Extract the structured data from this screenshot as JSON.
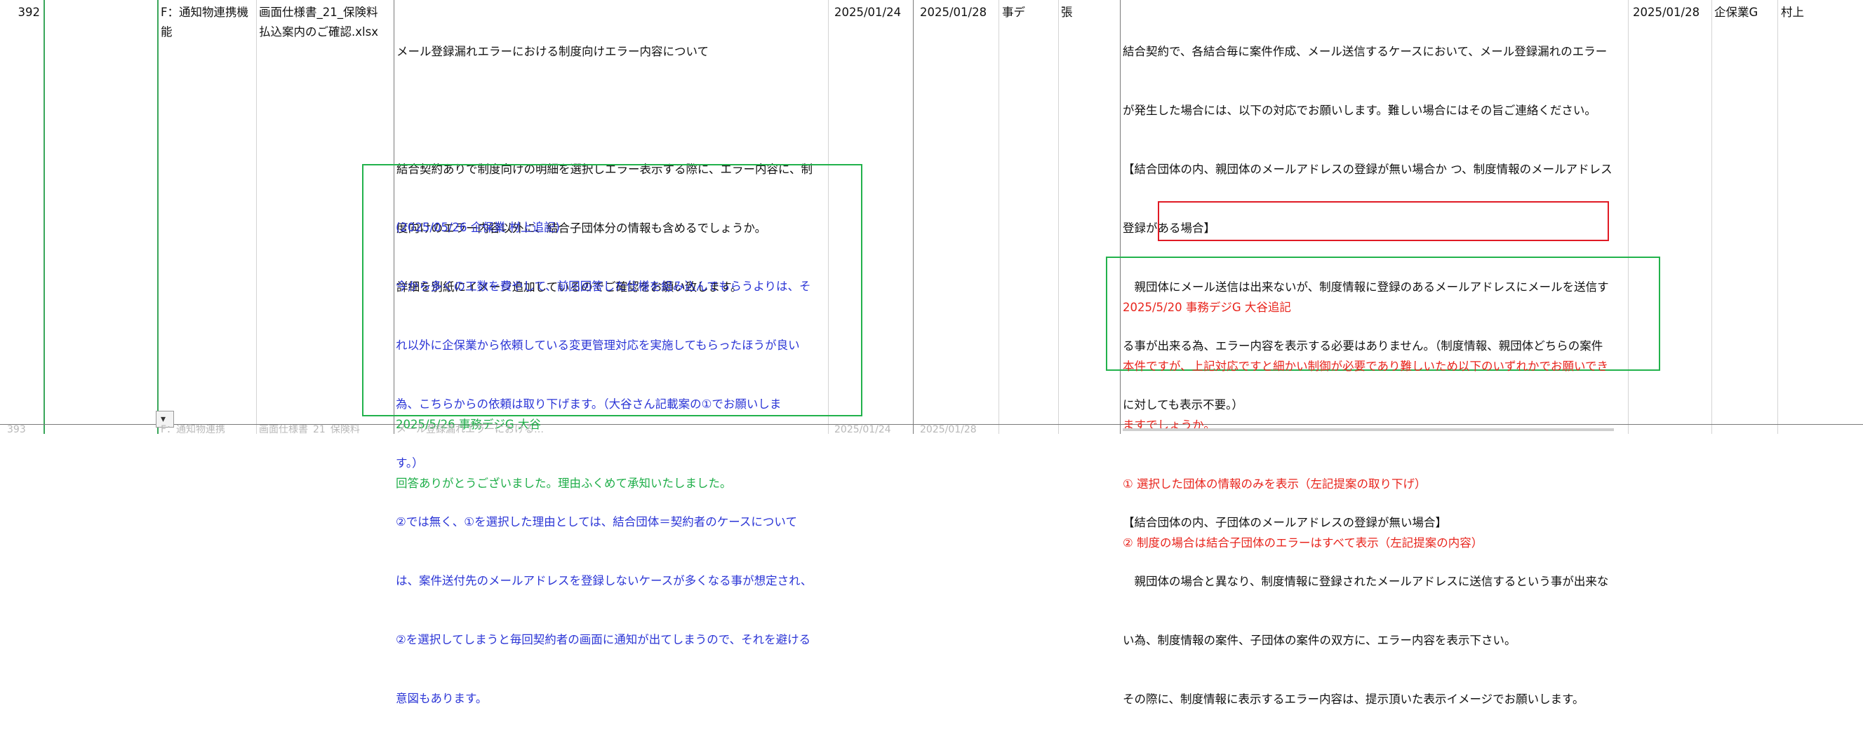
{
  "row": {
    "number": "392",
    "category": [
      "F：通知物連携機",
      "能"
    ],
    "document": [
      "画面仕様書_21_保険料",
      "払込案内のご確認.xlsx"
    ],
    "question_main": [
      "メール登録漏れエラーにおける制度向けエラー内容について",
      "",
      "結合契約ありで制度向けの明細を選択しエラー表示する際に、エラー内容に、制",
      "度向けのエラー内容以外に、結合子団体分の情報も含めるでしょうか。",
      "詳細を別紙にイメージ追加しているのでご確認をお願い致します。"
    ],
    "followup_blue": [
      "(2025/05/26 企保業 村上追記)",
      "今から多くの工数を費やして、前回回答した仕様を組み込んでもらうよりは、そ",
      "れ以外に企保業から依頼している変更管理対応を実施してもらったほうが良い",
      "為、こちらからの依頼は取り下げます。（大谷さん記載案の①でお願いしま",
      "す。）",
      "②では無く、①を選択した理由としては、結合団体＝契約者のケースについて",
      "は、案件送付先のメールアドレスを登録しないケースが多くなる事が想定され、",
      "②を選択してしまうと毎回契約者の画面に通知が出てしまうので、それを避ける",
      "意図もあります。"
    ],
    "followup_green": [
      "2025/5/26 事務デジG 大谷",
      "回答ありがとうございました。理由ふくめて承知いたしました。"
    ],
    "date_asked": "2025/01/24",
    "date_due": "2025/01/28",
    "asker_dept": "事デ",
    "asker": "張",
    "answer_main": [
      "結合契約で、各結合毎に案件作成、メール送信するケースにおいて、メール登録漏れのエラー",
      "が発生した場合には、以下の対応でお願いします。難しい場合にはその旨ご連絡ください。",
      "【結合団体の内、親団体のメールアドレスの登録が無い場合か つ、制度情報のメールアドレス",
      "登録がある場合】",
      "　親団体にメール送信は出来ないが、制度情報に登録のあるメールアドレスにメールを送信す",
      "る事が出来る為、エラー内容を表示する必要はありません。（制度情報、親団体どちらの案件",
      "に対しても表示不要。）",
      "",
      "【結合団体の内、子団体のメールアドレスの登録が無い場合】",
      "　親団体の場合と異なり、制度情報に登録されたメールアドレスに送信するという事が出来な",
      "い為、制度情報の案件、子団体の案件の双方に、エラー内容を表示下さい。",
      "その際に、制度情報に表示するエラー内容は、提示頂いた表示イメージでお願いします。"
    ],
    "answer_red": [
      "2025/5/20 事務デジG 大谷追記",
      "本件ですが、上記対応ですと細かい制御が必要であり難しいため以下のいずれかでお願いでき",
      "ますでしょうか。",
      "① 選択した団体の情報のみを表示（左記提案の取り下げ）",
      "② 制度の場合は結合子団体のエラーはすべて表示（左記提案の内容）"
    ],
    "answer_date": "2025/01/28",
    "answer_dept": "企保業G",
    "answerer": "村上"
  },
  "next_row_partial": {
    "number": "393",
    "category": "F：通知物連携",
    "document": "画面仕様書_21_保険料",
    "question": "メール登録漏れエラーにおける…",
    "date_asked": "2025/01/24",
    "date_due": "2025/01/28"
  },
  "dropdown_icon": "chevron-down-icon",
  "colors": {
    "blue_text": "#2b35d6",
    "green_text": "#1fae49",
    "red_text": "#e8241c",
    "green_border": "#22b24c",
    "red_border": "#e01a24"
  }
}
